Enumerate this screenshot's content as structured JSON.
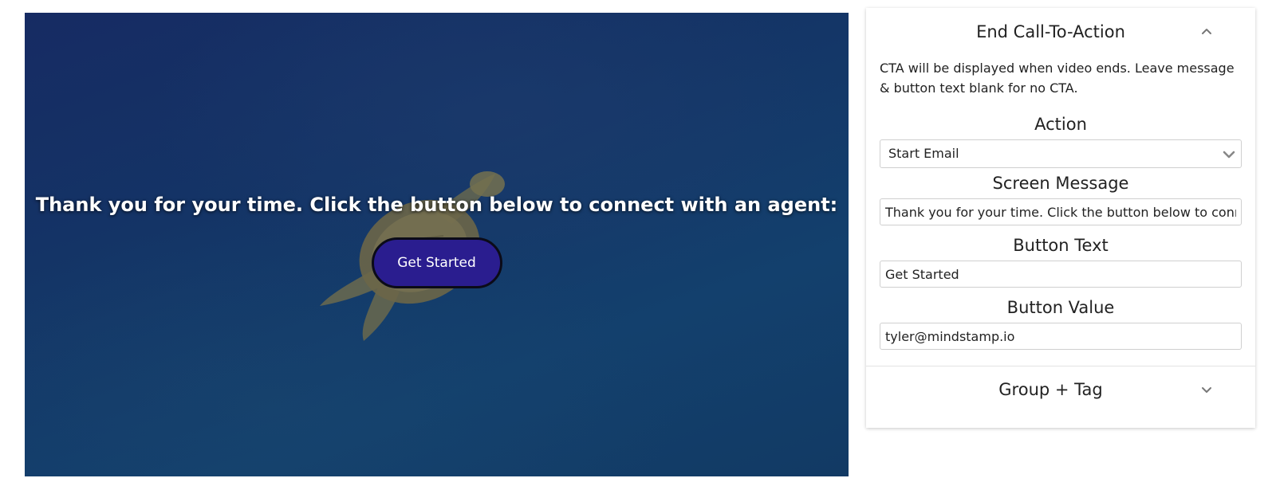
{
  "video": {
    "message": "Thank you for your time. Click the button below to connect with an agent:",
    "button_label": "Get Started"
  },
  "panel": {
    "cta_section": {
      "title": "End Call-To-Action",
      "chevron_icon": "chevron-up-icon",
      "description": "CTA will be displayed when video ends. Leave message & button text blank for no CTA.",
      "action_label": "Action",
      "action_value": "Start Email",
      "screen_message_label": "Screen Message",
      "screen_message_value": "Thank you for your time. Click the button below to connect with an agent:",
      "button_text_label": "Button Text",
      "button_text_value": "Get Started",
      "button_value_label": "Button Value",
      "button_value_value": "tyler@mindstamp.io"
    },
    "group_section": {
      "title": "Group + Tag",
      "chevron_icon": "chevron-down-icon"
    }
  },
  "colors": {
    "cta_button": "#2a1d8f",
    "video_background": "#143466"
  }
}
